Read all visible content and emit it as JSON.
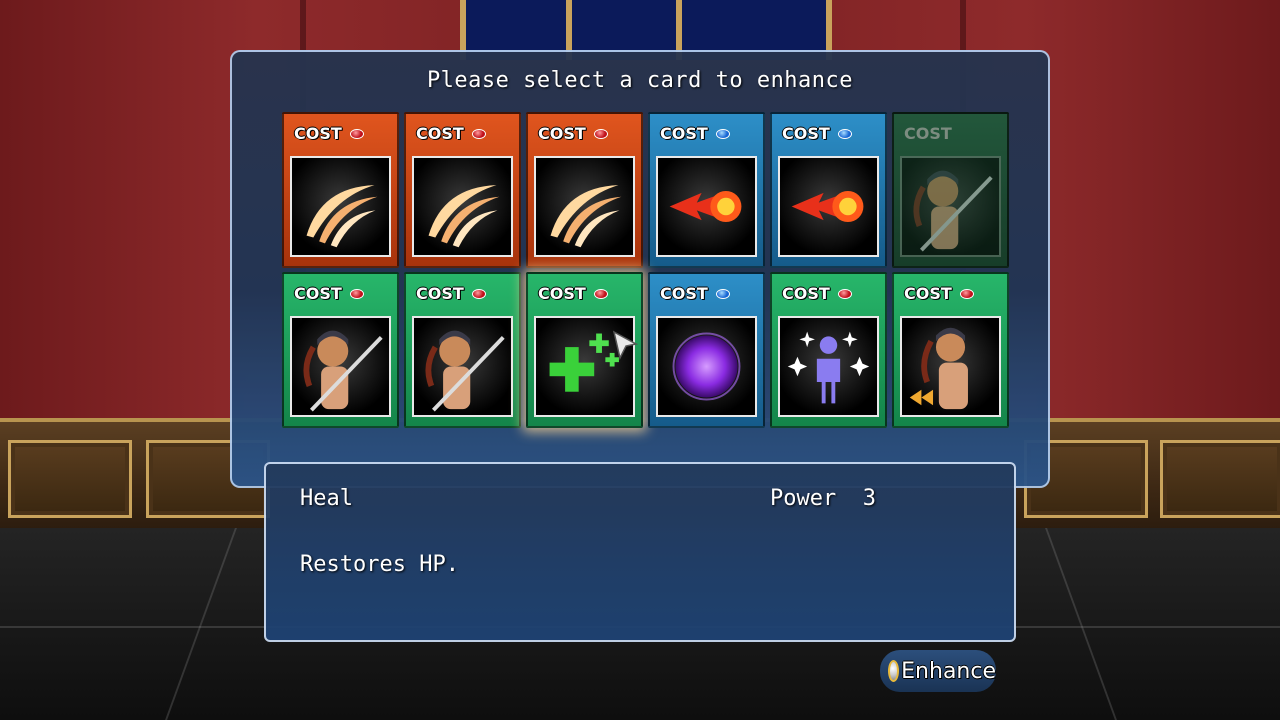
{
  "dialog": {
    "title": "Please select a card to enhance"
  },
  "cards": [
    {
      "cost_label": "COST",
      "gem": "red",
      "art": "slash-icon",
      "frame": "orange"
    },
    {
      "cost_label": "COST",
      "gem": "red",
      "art": "slash-icon",
      "frame": "orange"
    },
    {
      "cost_label": "COST",
      "gem": "red",
      "art": "slash-icon",
      "frame": "orange"
    },
    {
      "cost_label": "COST",
      "gem": "blue",
      "art": "fireball-icon",
      "frame": "blue"
    },
    {
      "cost_label": "COST",
      "gem": "blue",
      "art": "fireball-icon",
      "frame": "blue"
    },
    {
      "cost_label": "COST",
      "gem": "none",
      "art": "swordswoman-portrait",
      "frame": "green",
      "disabled": true
    },
    {
      "cost_label": "COST",
      "gem": "red",
      "art": "swordswoman-portrait",
      "frame": "green"
    },
    {
      "cost_label": "COST",
      "gem": "red",
      "art": "swordswoman-portrait",
      "frame": "green"
    },
    {
      "cost_label": "COST",
      "gem": "red",
      "art": "heal-plus-icon",
      "frame": "green",
      "selected": true
    },
    {
      "cost_label": "COST",
      "gem": "blue",
      "art": "dark-orb-icon",
      "frame": "blue"
    },
    {
      "cost_label": "COST",
      "gem": "red",
      "art": "sparkle-figure-icon",
      "frame": "green"
    },
    {
      "cost_label": "COST",
      "gem": "red",
      "art": "swordswoman-retreat-portrait",
      "frame": "green"
    }
  ],
  "details": {
    "name": "Heal",
    "power_text": "Power  3",
    "description": "Restores HP."
  },
  "enhance_button": {
    "label": "Enhance",
    "icon": "confirm-button-icon"
  },
  "colors": {
    "card_orange": "#d24a1a",
    "card_blue": "#2178b0",
    "card_green": "#20a45e",
    "gem_red": "#d0121c",
    "gem_blue": "#1a6fe0",
    "window_border": "#c8e1ff"
  }
}
